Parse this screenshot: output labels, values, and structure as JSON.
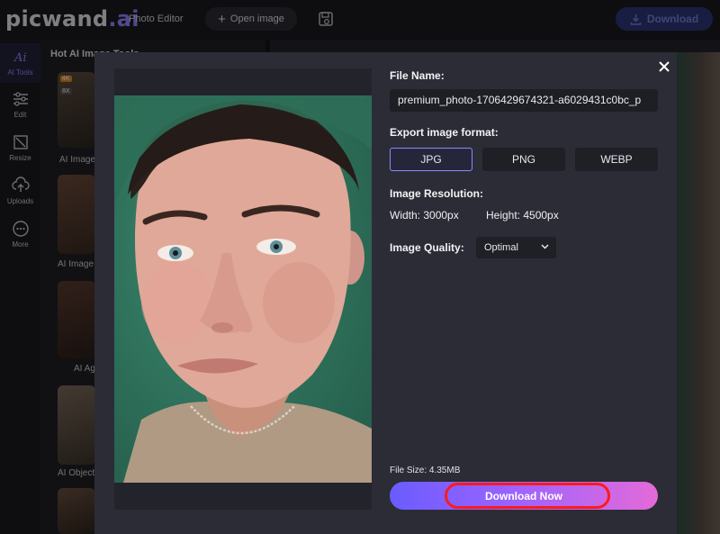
{
  "header": {
    "logo_main": "picwand",
    "logo_dot": ".",
    "logo_ai": "ai",
    "nav_photo_editor": "Photo Editor",
    "open_image_label": "Open image",
    "download_label": "Download"
  },
  "rail": {
    "items": [
      {
        "label": "AI Tools",
        "icon": "ai-tools-icon"
      },
      {
        "label": "Edit",
        "icon": "sliders-icon"
      },
      {
        "label": "Resize",
        "icon": "resize-icon"
      },
      {
        "label": "Uploads",
        "icon": "upload-icon"
      },
      {
        "label": "More",
        "icon": "more-icon"
      }
    ]
  },
  "tools": {
    "title": "Hot AI Image Tools",
    "badge_4x": "4K",
    "badge_8x": "8X",
    "labels": [
      "AI Image",
      "AI Image",
      "AI Ag",
      "AI Object"
    ]
  },
  "modal": {
    "file_name_label": "File Name:",
    "file_name_value": "premium_photo-1706429674321-a6029431c0bc_p",
    "export_format_label": "Export image format:",
    "formats": [
      "JPG",
      "PNG",
      "WEBP"
    ],
    "selected_format": "JPG",
    "resolution_label": "Image Resolution:",
    "width_text": "Width: 3000px",
    "height_text": "Height: 4500px",
    "quality_label": "Image Quality:",
    "quality_value": "Optimal",
    "file_size": "File Size: 4.35MB",
    "download_now": "Download Now"
  },
  "colors": {
    "accent": "#8f86ff",
    "highlight": "#ff1a1a",
    "modal_bg": "#2c2c36"
  }
}
